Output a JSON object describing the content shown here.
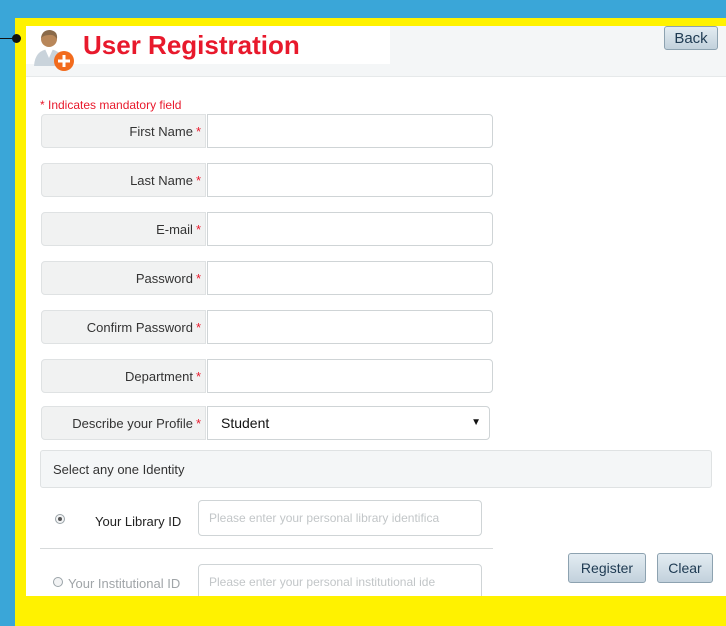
{
  "header": {
    "title": "User Registration",
    "back_label": "Back",
    "icon": "user-add-icon"
  },
  "form": {
    "mandatory_note": "* Indicates mandatory field",
    "required_marker": "*",
    "fields": [
      {
        "label": "First Name",
        "value": ""
      },
      {
        "label": "Last Name",
        "value": ""
      },
      {
        "label": "E-mail",
        "value": ""
      },
      {
        "label": "Password",
        "value": ""
      },
      {
        "label": "Confirm Password",
        "value": ""
      },
      {
        "label": "Department",
        "value": ""
      }
    ],
    "profile": {
      "label": "Describe your Profile",
      "selected": "Student"
    }
  },
  "identity": {
    "heading": "Select any one Identity",
    "options": [
      {
        "label": "Your Library ID",
        "placeholder": "Please enter your personal library identifica",
        "selected": true
      },
      {
        "label": "Your Institutional ID",
        "placeholder": "Please enter your personal institutional ide",
        "selected": false
      }
    ]
  },
  "actions": {
    "register_label": "Register",
    "clear_label": "Clear"
  },
  "colors": {
    "background": "#3aa6d8",
    "frame": "#fff200",
    "title": "#e8192c",
    "required": "#e8192c"
  }
}
